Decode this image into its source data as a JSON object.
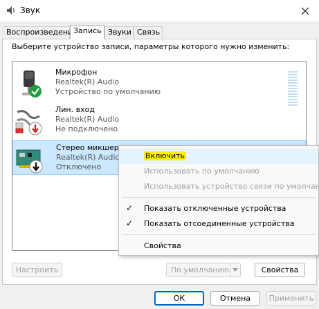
{
  "window": {
    "title": "Звук",
    "title_icon": "speaker-icon",
    "close_icon": "close-icon"
  },
  "tabs": [
    {
      "label": "Воспроизведение"
    },
    {
      "label": "Запись",
      "active": true
    },
    {
      "label": "Звуки"
    },
    {
      "label": "Связь"
    }
  ],
  "instruction": "Выберите устройство записи, параметры которого нужно изменить:",
  "devices": [
    {
      "name": "Микрофон",
      "driver": "Realtek(R) Audio",
      "status": "Устройство по умолчанию",
      "icon": "microphone-icon",
      "badge": "green-check-badge"
    },
    {
      "name": "Лин. вход",
      "driver": "Realtek(R) Audio",
      "status": "Не подключено",
      "icon": "line-in-cable-icon",
      "badge": "red-down-arrow-badge"
    },
    {
      "name": "Стерео микшер",
      "driver": "Realtek(R) Audio",
      "status": "Отключено",
      "icon": "sound-card-icon",
      "badge": "black-down-arrow-badge"
    }
  ],
  "context_menu": {
    "items": [
      {
        "label": "Включить",
        "enabled": true,
        "highlighted": true
      },
      {
        "label": "Использовать по умолчанию",
        "enabled": false
      },
      {
        "label": "Использовать устройство связи по умолчанию",
        "enabled": false
      },
      {
        "label": "Показать отключенные устройства",
        "enabled": true,
        "checked": true
      },
      {
        "label": "Показать отсоединенные устройства",
        "enabled": true,
        "checked": true
      },
      {
        "label": "Свойства",
        "enabled": true
      }
    ],
    "check_glyph": "✓",
    "highlight_color": "#fff200"
  },
  "buttons": {
    "configure": "Настроить",
    "default": "По умолчанию",
    "properties": "Свойства",
    "ok": "ОК",
    "cancel": "Отмена",
    "apply": "Применить"
  },
  "colors": {
    "selection": "#cce8ff",
    "accent": "#0067c0"
  }
}
